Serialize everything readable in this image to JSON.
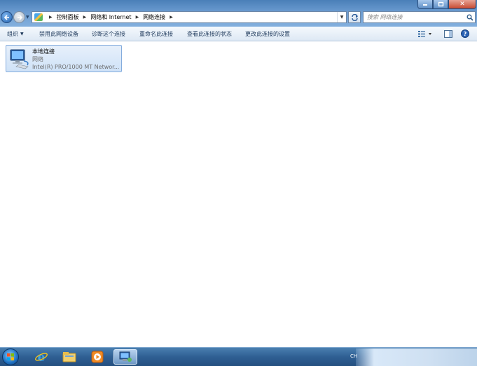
{
  "window": {
    "min_icon": "minimize-icon",
    "max_icon": "maximize-icon",
    "close_glyph": "✕"
  },
  "address": {
    "crumbs": [
      "控制面板",
      "网络和 Internet",
      "网络连接"
    ]
  },
  "search": {
    "placeholder": "搜索 网络连接"
  },
  "toolbar": {
    "items": [
      {
        "label": "组织",
        "has_dropdown": true
      },
      {
        "label": "禁用此网络设备"
      },
      {
        "label": "诊断这个连接"
      },
      {
        "label": "重命名此连接"
      },
      {
        "label": "查看此连接的状态"
      },
      {
        "label": "更改此连接的设置"
      }
    ],
    "views_icon": "views-icon",
    "preview_pane_icon": "preview-pane-icon",
    "help_icon": "help-icon"
  },
  "connection": {
    "name": "本地连接",
    "status": "网络",
    "device": "Intel(R) PRO/1000 MT Networ..."
  },
  "taskbar": {
    "apps": [
      "start-orb",
      "ie-icon",
      "explorer-icon",
      "media-player-icon",
      "network-connections-icon"
    ],
    "tray_lang": "CH"
  },
  "colors": {
    "accent": "#4a7fb8",
    "selection_bg": "#cfe2f7",
    "selection_border": "#84acdd",
    "close_red": "#c64a32"
  }
}
